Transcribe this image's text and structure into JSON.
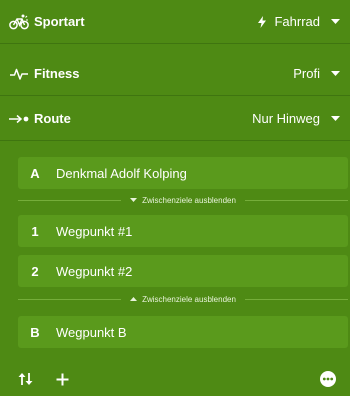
{
  "settings": {
    "sport": {
      "label": "Sportart",
      "value": "Fahrrad",
      "icon": "bicycle-icon",
      "value_icon": "bolt-icon"
    },
    "fitness": {
      "label": "Fitness",
      "value": "Profi",
      "icon": "pulse-icon"
    },
    "route": {
      "label": "Route",
      "value": "Nur Hinweg",
      "icon": "route-arrow-icon"
    }
  },
  "waypoints": {
    "start": {
      "letter": "A",
      "name": "Denkmal Adolf Kolping"
    },
    "toggle_top": "Zwischenziele ausblenden",
    "items": [
      {
        "letter": "1",
        "name": "Wegpunkt #1"
      },
      {
        "letter": "2",
        "name": "Wegpunkt #2"
      }
    ],
    "toggle_bottom": "Zwischenziele ausblenden",
    "end": {
      "letter": "B",
      "name": "Wegpunkt B"
    }
  },
  "footer": {
    "swap_icon": "swap-icon",
    "add_icon": "plus-icon",
    "more_icon": "more-icon"
  },
  "colors": {
    "background": "#4e8a14",
    "card": "#5a9a1c",
    "text": "#ffffff"
  }
}
